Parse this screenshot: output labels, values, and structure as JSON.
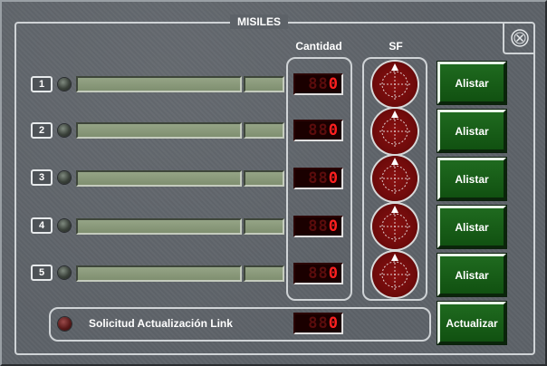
{
  "panel": {
    "title": "MISILES"
  },
  "headers": {
    "cantidad": "Cantidad",
    "sf": "SF"
  },
  "rows": [
    {
      "number": "1",
      "count_dim": "88",
      "count_lit": "0",
      "button_label": "Alistar"
    },
    {
      "number": "2",
      "count_dim": "88",
      "count_lit": "0",
      "button_label": "Alistar"
    },
    {
      "number": "3",
      "count_dim": "88",
      "count_lit": "0",
      "button_label": "Alistar"
    },
    {
      "number": "4",
      "count_dim": "88",
      "count_lit": "0",
      "button_label": "Alistar"
    },
    {
      "number": "5",
      "count_dim": "88",
      "count_lit": "0",
      "button_label": "Alistar"
    }
  ],
  "link": {
    "label": "Solicitud Actualización Link",
    "count_dim": "88",
    "count_lit": "0",
    "button_label": "Actualizar"
  },
  "colors": {
    "panel": "#5d6268",
    "button_green": "#1f6a1f",
    "counter_red": "#ff2020",
    "radar_red": "#8a1111"
  },
  "icons": {
    "close": "close-x-icon",
    "radar": "radar-crosshair-icon",
    "status_led": "status-led-icon"
  }
}
